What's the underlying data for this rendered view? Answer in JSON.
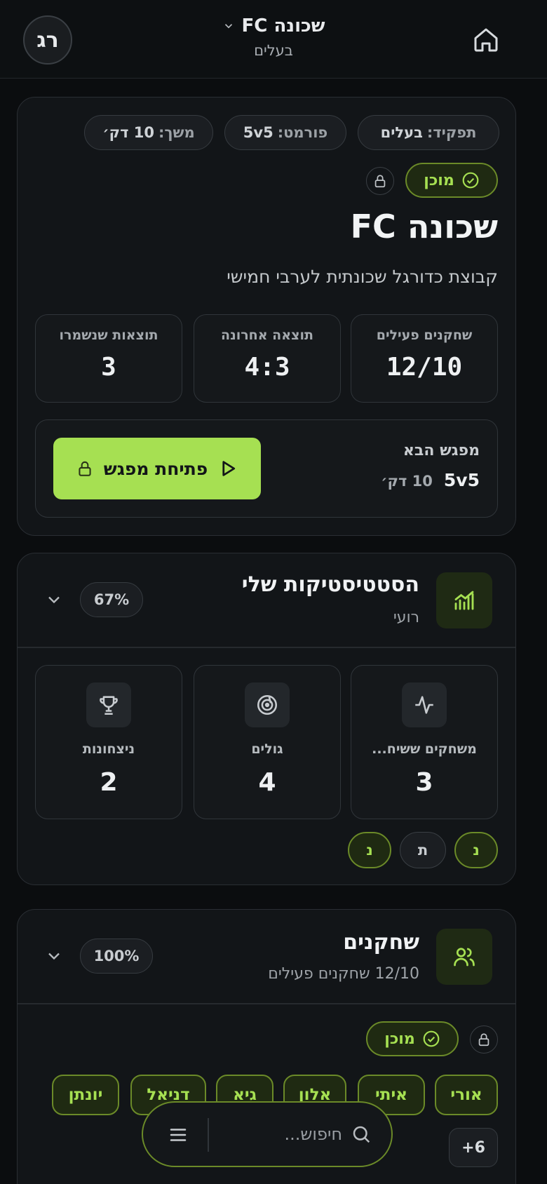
{
  "header": {
    "avatar_initials": "רג",
    "team_name": "שכונה FC",
    "team_role": "בעלים"
  },
  "team_card": {
    "pills": [
      {
        "key": "תפקיד:",
        "value": "בעלים"
      },
      {
        "key": "פורמט:",
        "value": "5v5"
      },
      {
        "key": "משך:",
        "value": "10 דק׳"
      }
    ],
    "status": "מוכן",
    "title": "שכונה FC",
    "description": "קבוצת כדורגל שכונתית לערבי חמישי",
    "stats": [
      {
        "label": "שחקנים פעילים",
        "value": "12/10"
      },
      {
        "label": "תוצאה אחרונה",
        "value": "4:3"
      },
      {
        "label": "תוצאות שנשמרו",
        "value": "3"
      }
    ],
    "next_match": {
      "label": "מפגש הבא",
      "format": "5v5",
      "duration": "10 דק׳",
      "button": "פתיחת מפגש"
    }
  },
  "my_stats": {
    "title": "הסטטיסטיקות שלי",
    "subtitle": "רועי",
    "percent": "67%",
    "items": [
      {
        "label": "משחקים ששיח...",
        "value": "3",
        "icon": "activity-icon"
      },
      {
        "label": "גולים",
        "value": "4",
        "icon": "goal-target-icon"
      },
      {
        "label": "ניצחונות",
        "value": "2",
        "icon": "trophy-icon"
      }
    ],
    "form": [
      "נ",
      "ת",
      "נ"
    ]
  },
  "players": {
    "title": "שחקנים",
    "subtitle": "12/10 שחקנים פעילים",
    "percent": "100%",
    "status": "מוכן",
    "names": [
      "אורי",
      "איתי",
      "אלון",
      "גיא",
      "דניאל",
      "יונתן"
    ],
    "more": "6+"
  },
  "search": {
    "placeholder": "חיפוש..."
  },
  "colors": {
    "accent": "#a6e052",
    "background": "#0b0d0f",
    "card": "#121518"
  }
}
